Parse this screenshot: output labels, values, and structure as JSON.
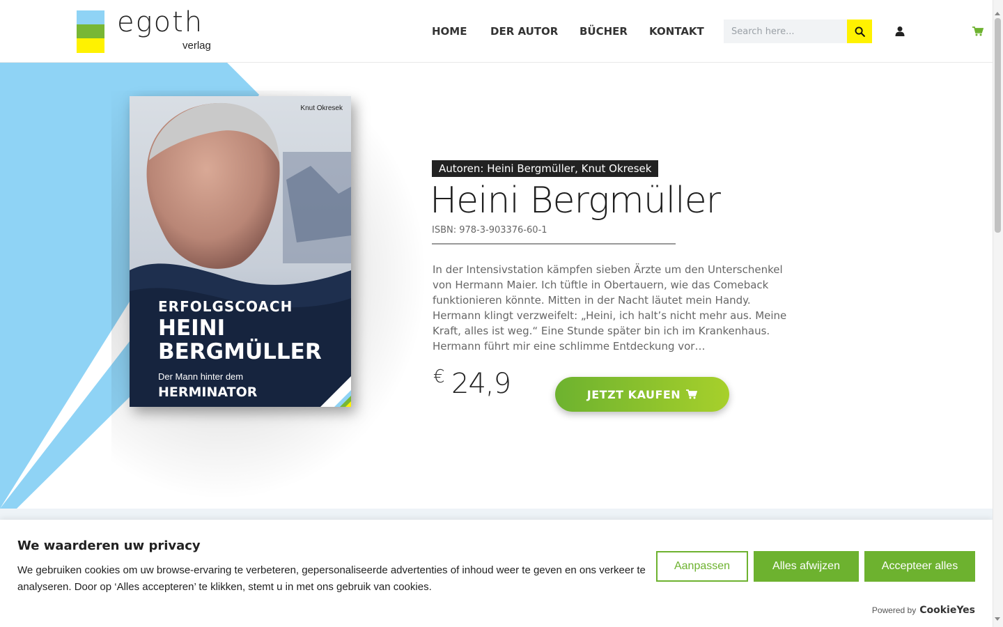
{
  "header": {
    "logo_word": "egoth",
    "logo_sub": "verlag",
    "nav": [
      "HOME",
      "DER AUTOR",
      "BÜCHER",
      "KONTAKT"
    ],
    "search_placeholder": "Search here..."
  },
  "product": {
    "authors": "Autoren: Heini Bergmüller, Knut Okresek",
    "title": "Heini Bergmüller",
    "isbn": "ISBN: 978-3-903376-60-1",
    "description": "In der Intensivstation kämpfen sieben Ärzte um den Unterschenkel von Hermann Maier. Ich tüftle in Obertauern, wie das Comeback funktionieren könnte. Mitten in der Nacht läutet mein Handy. Hermann klingt verzweifelt: „Heini, ich halt’s nicht mehr aus. Meine Kraft, alles ist weg.“ Eine Stunde später bin ich im Krankenhaus. Hermann führt mir eine schlimme Entdeckung vor…",
    "currency": "€",
    "price": "24,9",
    "buy_label": "JETZT KAUFEN"
  },
  "book_cover": {
    "author": "Knut Okresek",
    "line1": "ERFOLGSCOACH",
    "line2": "HEINI",
    "line3": "BERGMÜLLER",
    "line4": "Der Mann hinter dem",
    "line5": "HERMINATOR",
    "corner_logo": "egoth"
  },
  "cookie": {
    "title": "We waarderen uw privacy",
    "text": "We gebruiken cookies om uw browse-ervaring te verbeteren, gepersonaliseerde advertenties of inhoud weer te geven en ons verkeer te analyseren. Door op ‘Alles accepteren’ te klikken, stemt u in met ons gebruik van cookies.",
    "btn_customize": "Aanpassen",
    "btn_reject": "Alles afwijzen",
    "btn_accept": "Accepteer alles",
    "powered_by": "Powered by",
    "brand": "CookieYes"
  },
  "colors": {
    "accent_green": "#6db22f",
    "hero_blue": "#8fd3f5",
    "search_yellow": "#fff200"
  },
  "icons": [
    "search-icon",
    "user-icon",
    "cart-icon"
  ]
}
